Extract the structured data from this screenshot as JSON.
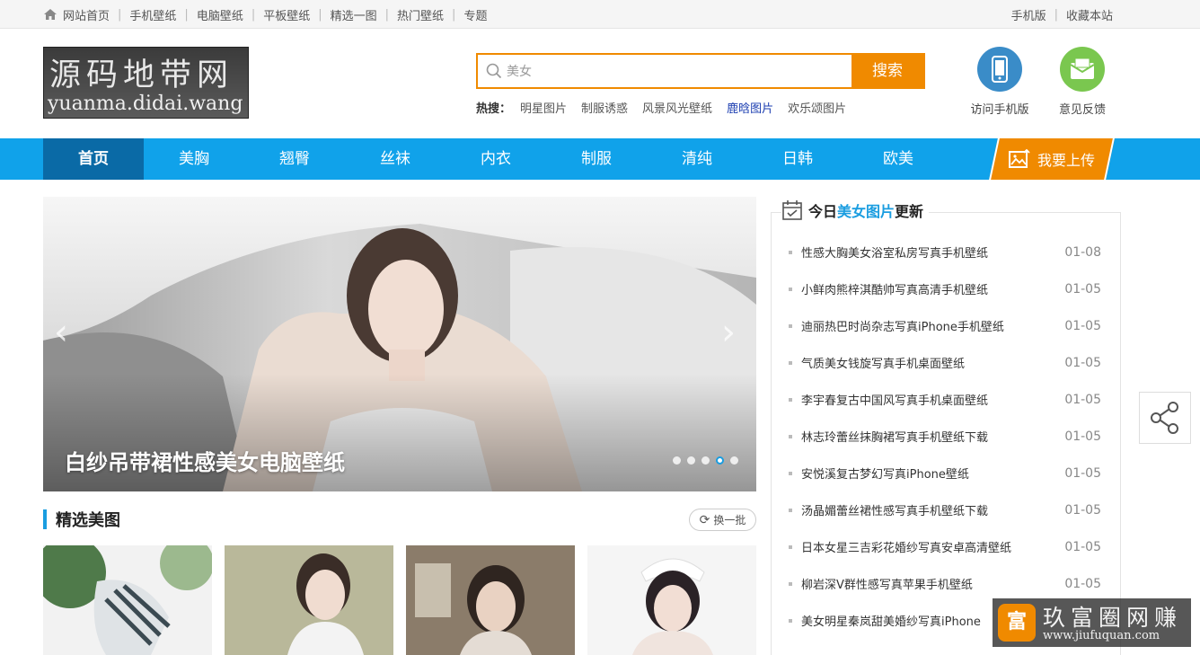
{
  "topbar": {
    "left": [
      "网站首页",
      "手机壁纸",
      "电脑壁纸",
      "平板壁纸",
      "精选一图",
      "热门壁纸",
      "专题"
    ],
    "right": [
      "手机版",
      "收藏本站"
    ]
  },
  "logo": {
    "line1": "源码地带网",
    "line2": "yuanma.didai.wang"
  },
  "search": {
    "value": "美女",
    "button": "搜索",
    "hot_label": "热搜：",
    "hot": [
      "明星图片",
      "制服诱惑",
      "风景风光壁纸",
      "鹿晗图片",
      "欢乐颂图片"
    ]
  },
  "header_buttons": {
    "mobile": "访问手机版",
    "feedback": "意见反馈"
  },
  "nav": {
    "items": [
      "首页",
      "美胸",
      "翘臀",
      "丝袜",
      "内衣",
      "制服",
      "清纯",
      "日韩",
      "欧美"
    ],
    "upload": "我要上传"
  },
  "slider": {
    "caption": "白纱吊带裙性感美女电脑壁纸",
    "prev": "‹",
    "next": "›"
  },
  "featured": {
    "title": "精选美图",
    "refresh": "换一批"
  },
  "updates": {
    "title_a": "今日",
    "title_hl": "美女图片",
    "title_b": "更新",
    "items": [
      {
        "title": "性感大胸美女浴室私房写真手机壁纸",
        "date": "01-08"
      },
      {
        "title": "小鲜肉熊梓淇酷帅写真高清手机壁纸",
        "date": "01-05"
      },
      {
        "title": "迪丽热巴时尚杂志写真iPhone手机壁纸",
        "date": "01-05"
      },
      {
        "title": "气质美女钱旋写真手机桌面壁纸",
        "date": "01-05"
      },
      {
        "title": "李宇春复古中国风写真手机桌面壁纸",
        "date": "01-05"
      },
      {
        "title": "林志玲蕾丝抹胸裙写真手机壁纸下载",
        "date": "01-05"
      },
      {
        "title": "安悦溪复古梦幻写真iPhone壁纸",
        "date": "01-05"
      },
      {
        "title": "汤晶媚蕾丝裙性感写真手机壁纸下载",
        "date": "01-05"
      },
      {
        "title": "日本女星三吉彩花婚纱写真安卓高清壁纸",
        "date": "01-05"
      },
      {
        "title": "柳岩深V群性感写真苹果手机壁纸",
        "date": "01-05"
      },
      {
        "title": "美女明星秦岚甜美婚纱写真iPhone",
        "date": ""
      }
    ]
  },
  "watermark": {
    "face": "富",
    "line1": "玖富圈网赚",
    "line2": "www.jiufuquan.com"
  }
}
